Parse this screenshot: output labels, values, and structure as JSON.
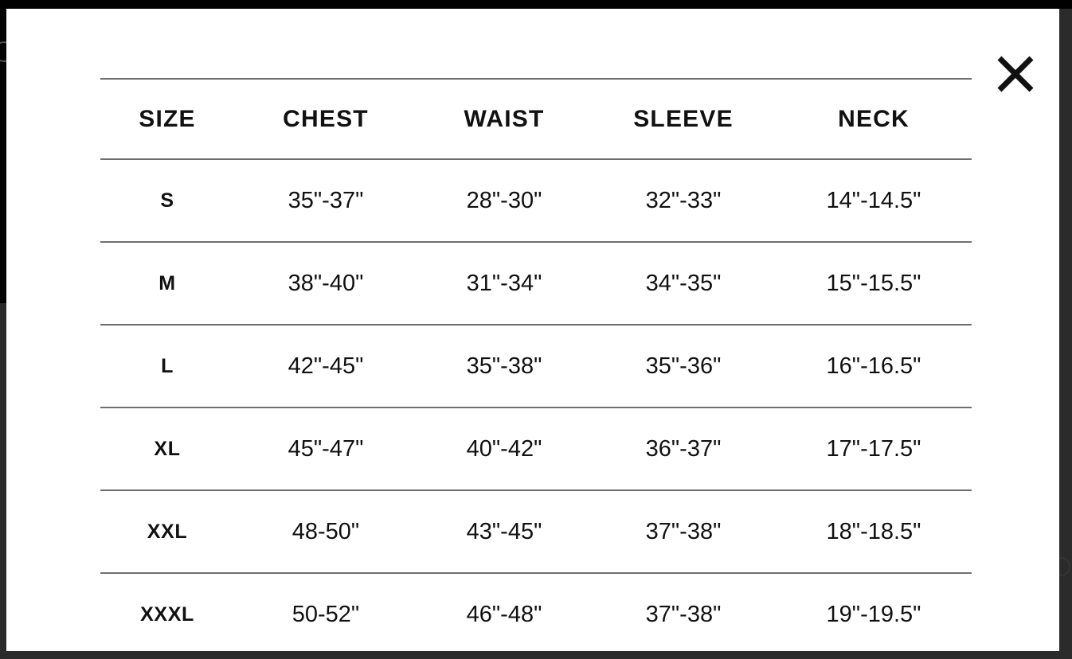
{
  "modal": {
    "close_label": "×",
    "close_icon": "close-x-icon"
  },
  "size_chart": {
    "columns": [
      "SIZE",
      "CHEST",
      "WAIST",
      "SLEEVE",
      "NECK"
    ],
    "rows": [
      {
        "size": "S",
        "chest": "35\"-37\"",
        "waist": "28\"-30\"",
        "sleeve": "32\"-33\"",
        "neck": "14\"-14.5\""
      },
      {
        "size": "M",
        "chest": "38\"-40\"",
        "waist": "31\"-34\"",
        "sleeve": "34\"-35\"",
        "neck": "15\"-15.5\""
      },
      {
        "size": "L",
        "chest": "42\"-45\"",
        "waist": "35\"-38\"",
        "sleeve": "35\"-36\"",
        "neck": "16\"-16.5\""
      },
      {
        "size": "XL",
        "chest": "45\"-47\"",
        "waist": "40\"-42\"",
        "sleeve": "36\"-37\"",
        "neck": "17\"-17.5\""
      },
      {
        "size": "XXL",
        "chest": "48-50\"",
        "waist": "43\"-45\"",
        "sleeve": "37\"-38\"",
        "neck": "18\"-18.5\""
      },
      {
        "size": "XXXL",
        "chest": "50-52\"",
        "waist": "46\"-48\"",
        "sleeve": "37\"-38\"",
        "neck": "19\"-19.5\""
      }
    ]
  },
  "colors": {
    "text": "#111111",
    "rule": "#6e6e6e",
    "backdrop": "#2b2b2b",
    "sheet": "#ffffff"
  }
}
